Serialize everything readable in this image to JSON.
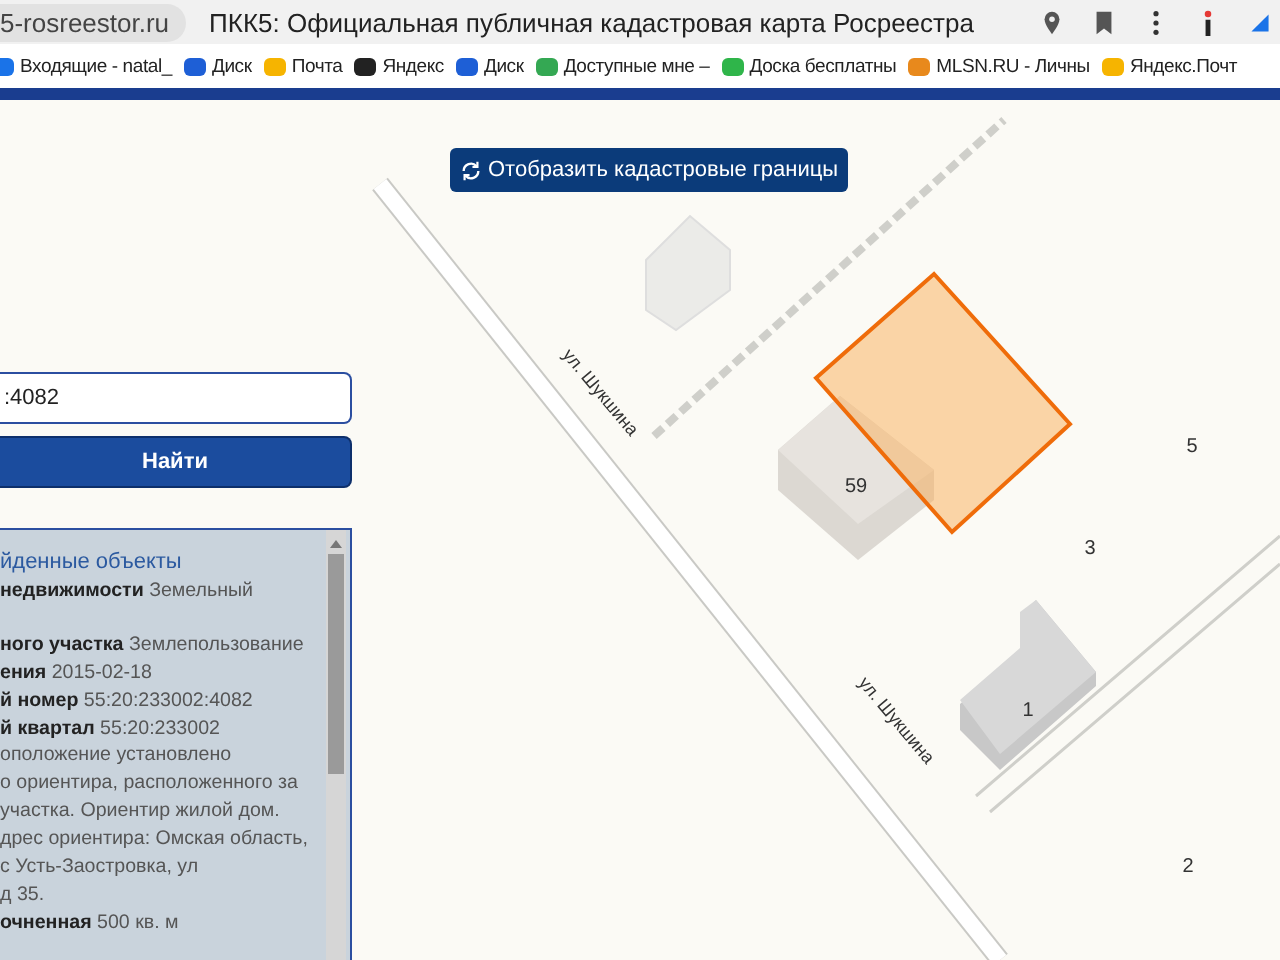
{
  "browser": {
    "domain": "5-rosreestor.ru",
    "title": "ПКК5: Официальная публичная кадастровая карта Росреестра",
    "bookmarks": [
      {
        "label": "Входящие - natal_",
        "color": "#1a73e8"
      },
      {
        "label": "Диск",
        "color": "#1e5fd6"
      },
      {
        "label": "Почта",
        "color": "#f6b400"
      },
      {
        "label": "Яндекс",
        "color": "#222222"
      },
      {
        "label": "Диск",
        "color": "#1e5fd6"
      },
      {
        "label": "Доступные мне –",
        "color": "#34a853"
      },
      {
        "label": "Доска бесплатны",
        "color": "#2fb54a"
      },
      {
        "label": "MLSN.RU - Личны",
        "color": "#e8891c"
      },
      {
        "label": "Яндекс.Почт",
        "color": "#f6b400"
      }
    ]
  },
  "map": {
    "toggle_button": "Отобразить кадастровые границы",
    "street_labels": [
      "ул. Шукшина",
      "ул. Шукшина"
    ],
    "house_numbers": [
      "59",
      "5",
      "3",
      "1",
      "2"
    ]
  },
  "search": {
    "value": ":4082",
    "button": "Найти"
  },
  "results": {
    "heading": "йденные объекты",
    "lines": [
      "**недвижимости** Земельный",
      "**ного участка** Землепользование",
      "**ения** 2015-02-18",
      "**й номер** 55:20:233002:4082",
      "**й квартал** 55:20:233002",
      "оположение установлено",
      "о ориентира, расположенного за",
      "участка. Ориентир жилой дом.",
      "дрес ориентира: Омская область,",
      "с Усть-Заостровка, ул",
      "д 35.",
      "**очненная** 500 кв. м"
    ]
  }
}
